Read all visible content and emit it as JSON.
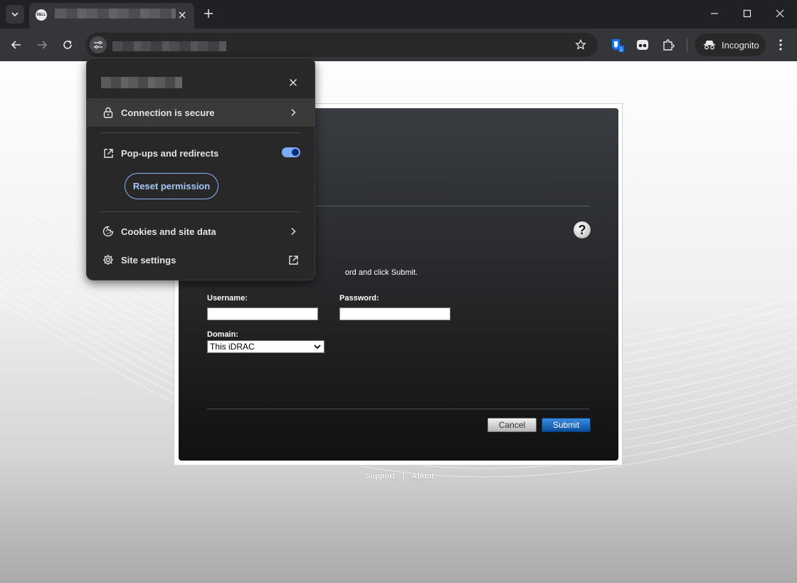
{
  "browser": {
    "tab_title": "",
    "favicon_text": "DELL",
    "url": "",
    "incognito_label": "Incognito",
    "extension_badge": "1"
  },
  "login": {
    "instructions": "ord and click Submit.",
    "username_label": "Username:",
    "password_label": "Password:",
    "domain_label": "Domain:",
    "domain_value": "This iDRAC",
    "username_value": "",
    "password_value": "",
    "help_symbol": "?",
    "cancel_label": "Cancel",
    "submit_label": "Submit",
    "footer_support": "Support",
    "footer_separator": "|",
    "footer_about": "About"
  },
  "site_info_popup": {
    "title": "",
    "connection_label": "Connection is secure",
    "popups_label": "Pop-ups and redirects",
    "popups_enabled": true,
    "reset_permission_label": "Reset permission",
    "cookies_label": "Cookies and site data",
    "site_settings_label": "Site settings"
  },
  "colors": {
    "accent": "#8ab4f8",
    "submit_blue": "#0a4f9d",
    "toggle_on": "#7cacf8"
  }
}
